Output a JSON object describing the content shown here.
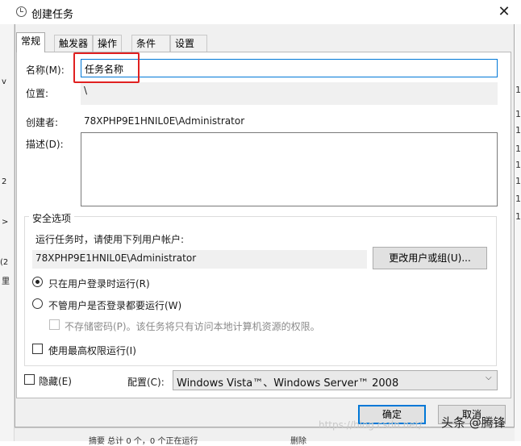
{
  "window": {
    "title": "创建任务",
    "close_glyph": "✕"
  },
  "tabs": [
    {
      "label": "常规",
      "active": true
    },
    {
      "label": "触发器",
      "active": false
    },
    {
      "label": "操作",
      "active": false
    },
    {
      "label": "条件",
      "active": false
    },
    {
      "label": "设置",
      "active": false
    }
  ],
  "general": {
    "name_label": "名称(M):",
    "name_value": "任务名称",
    "location_label": "位置:",
    "location_value": "\\",
    "author_label": "创建者:",
    "author_value": "78XPHP9E1HNIL0E\\Administrator",
    "description_label": "描述(D):",
    "description_value": ""
  },
  "security": {
    "title": "安全选项",
    "run_as_text": "运行任务时，请使用下列用户帐户:",
    "account_value": "78XPHP9E1HNIL0E\\Administrator",
    "change_user_button": "更改用户或组(U)...",
    "radio_logged_on": "只在用户登录时运行(R)",
    "radio_logged_on_selected": true,
    "radio_whether_logged": "不管用户是否登录都要运行(W)",
    "radio_whether_logged_selected": false,
    "no_store_password": "不存储密码(P)。该任务将只有访问本地计算机资源的权限。",
    "highest_privileges": "使用最高权限运行(I)"
  },
  "footer": {
    "hidden_label": "隐藏(E)",
    "configure_label": "配置(C):",
    "configure_value": "Windows Vista™、Windows Server™ 2008",
    "ok_button": "确定",
    "cancel_button": "取消"
  },
  "watermark": {
    "url": "https://blog.csdn.net/...",
    "brand": "头条 @腾锋"
  },
  "background": {
    "bottom_left_text": "摘要  总计 0 个，0 个正在运行",
    "bottom_right_text": "删除",
    "right_edge_chars": [
      "1",
      "1",
      "1",
      "1",
      "1",
      "1",
      "1",
      "1"
    ],
    "left_edge_chars": [
      "v",
      "2",
      ">",
      "(2",
      "里"
    ]
  },
  "colors": {
    "accent": "#0078d7",
    "highlight_box": "#e02020",
    "dialog_bg": "#f0f0f0"
  }
}
